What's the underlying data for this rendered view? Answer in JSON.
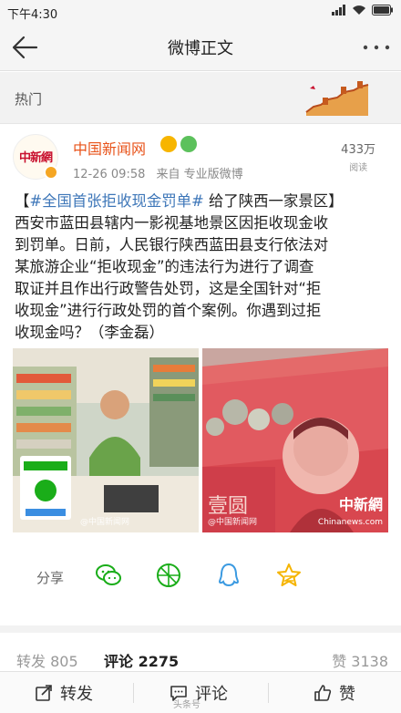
{
  "status": {
    "time": "下午4:30",
    "battery": "battery-icon",
    "wifi": "wifi-icon",
    "signal": "signal-icon"
  },
  "nav": {
    "title": "微博正文",
    "back_icon": "back-arrow-icon",
    "more_icon": "more-dots-icon"
  },
  "section": {
    "label": "热门"
  },
  "post": {
    "author": "中国新闻网",
    "avatar_text": "中新網",
    "time": "12-26 09:58",
    "source": "来自 专业版微博",
    "reads_count": "433万",
    "reads_label": "阅读",
    "text_lines": [
      {
        "pre": "【",
        "tag": "#全国首张拒收现金罚单#",
        "post": " 给了陕西一家景区】"
      },
      {
        "pre": "西安市蓝田县辖内一影视基地景区因拒收现金收",
        "tag": "",
        "post": ""
      },
      {
        "pre": "到罚单。日前，人民银行陕西蓝田县支行依法对",
        "tag": "",
        "post": ""
      },
      {
        "pre": "某旅游企业“拒收现金”的违法行为进行了调查",
        "tag": "",
        "post": ""
      },
      {
        "pre": "取证并且作出行政警告处罚，这是全国针对“拒",
        "tag": "",
        "post": ""
      },
      {
        "pre": "收现金”进行行政处罚的首个案例。你遇到过拒",
        "tag": "",
        "post": ""
      },
      {
        "pre": "收现金吗？（李金磊）",
        "tag": "",
        "post": ""
      }
    ],
    "image_left_watermark": "@中国新闻网",
    "image_right_watermark": "@中国新闻网",
    "image_right_logo": "中新網",
    "image_right_site": "Chinanews.com"
  },
  "share": {
    "label": "分享",
    "icons": [
      "wechat-icon",
      "moments-icon",
      "qq-icon",
      "qzone-icon"
    ]
  },
  "counts": {
    "repost": "转发 805",
    "comment": "评论 2275",
    "like": "赞 3138"
  },
  "bottom": {
    "repost": "转发",
    "comment": "评论",
    "like": "赞",
    "watermark": "头条号"
  },
  "colors": {
    "accent": "#e8531a",
    "link": "#3d76b8",
    "wechat": "#1aad19",
    "qq": "#3b9ae1",
    "qzone": "#f5b400"
  }
}
